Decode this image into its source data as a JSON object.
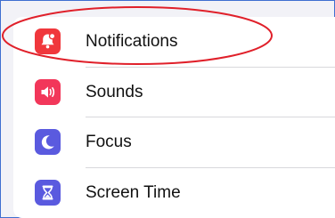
{
  "settings": {
    "items": [
      {
        "label": "Notifications",
        "icon": "bell-badge-icon",
        "color": "#f0373c"
      },
      {
        "label": "Sounds",
        "icon": "speaker-icon",
        "color": "#f2375a"
      },
      {
        "label": "Focus",
        "icon": "moon-icon",
        "color": "#5a5adf"
      },
      {
        "label": "Screen Time",
        "icon": "hourglass-icon",
        "color": "#5a5adf"
      }
    ]
  },
  "annotation": {
    "color": "#e0202a"
  }
}
